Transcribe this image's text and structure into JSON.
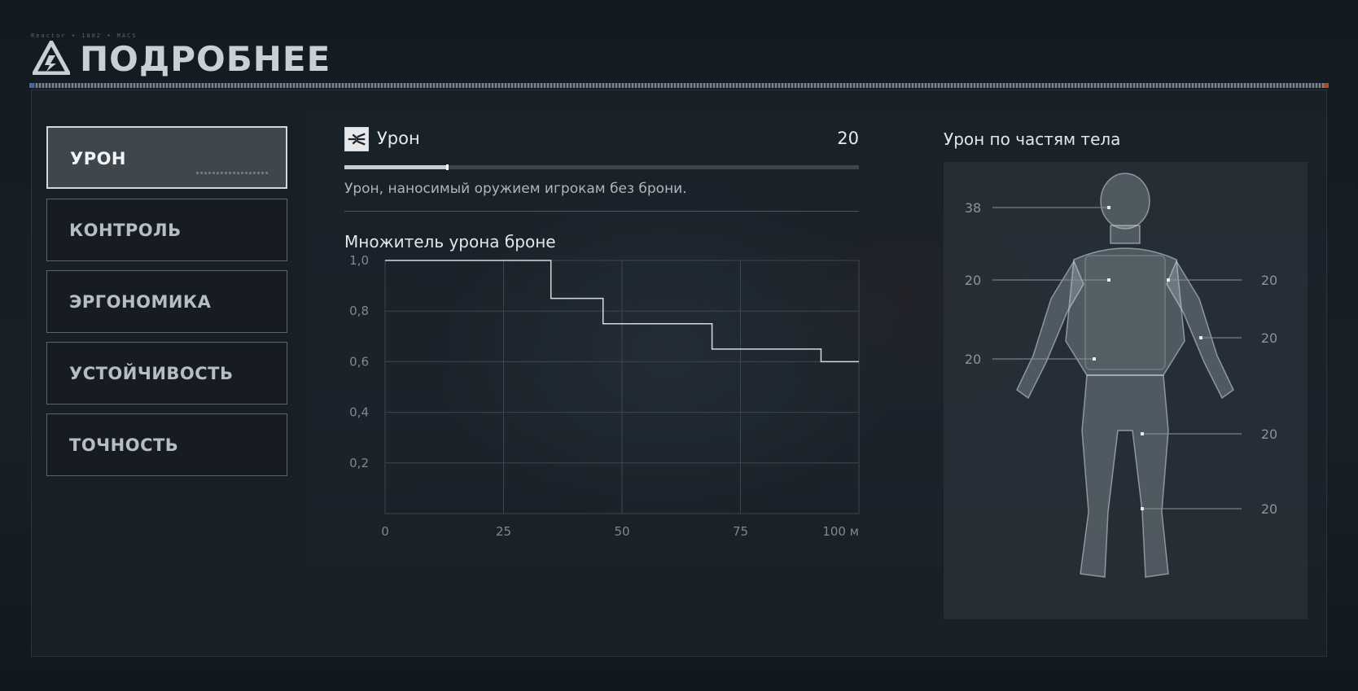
{
  "header": {
    "tiny_text": "Reactor • 1002 • MACS",
    "title": "ПОДРОБНЕЕ"
  },
  "tabs": [
    {
      "label": "УРОН",
      "active": true
    },
    {
      "label": "КОНТРОЛЬ",
      "active": false
    },
    {
      "label": "ЭРГОНОМИКА",
      "active": false
    },
    {
      "label": "УСТОЙЧИВОСТЬ",
      "active": false
    },
    {
      "label": "ТОЧНОСТЬ",
      "active": false
    }
  ],
  "stat": {
    "icon": "bullet-damage-icon",
    "label": "Урон",
    "value": "20",
    "bar_fraction": 0.2,
    "description": "Урон, наносимый оружием игрокам без брони."
  },
  "chart_data": {
    "type": "line",
    "title": "Множитель урона броне",
    "x": [
      0,
      35,
      35,
      46,
      46,
      69,
      69,
      92,
      92,
      100
    ],
    "y": [
      1.0,
      1.0,
      0.85,
      0.85,
      0.75,
      0.75,
      0.65,
      0.65,
      0.6,
      0.6
    ],
    "xticks": [
      "0",
      "25",
      "50",
      "75",
      "100 м"
    ],
    "xtick_values": [
      0,
      25,
      50,
      75,
      100
    ],
    "yticks": [
      "1,0",
      "0,8",
      "0,6",
      "0,4",
      "0,2"
    ],
    "ytick_values": [
      1.0,
      0.8,
      0.6,
      0.4,
      0.2
    ],
    "xlim": [
      0,
      100
    ],
    "ylim": [
      0,
      1.0
    ],
    "grid": true
  },
  "body": {
    "title": "Урон по частям тела",
    "parts": [
      {
        "name": "head",
        "value": "38"
      },
      {
        "name": "torso",
        "value": "20"
      },
      {
        "name": "upper-arm",
        "value": "20"
      },
      {
        "name": "forearm",
        "value": "20"
      },
      {
        "name": "stomach",
        "value": "20"
      },
      {
        "name": "thigh",
        "value": "20"
      },
      {
        "name": "shin",
        "value": "20"
      }
    ]
  },
  "colors": {
    "background": "#111820",
    "active_tab": "#3f464c",
    "chart_line": "#d6dade"
  }
}
